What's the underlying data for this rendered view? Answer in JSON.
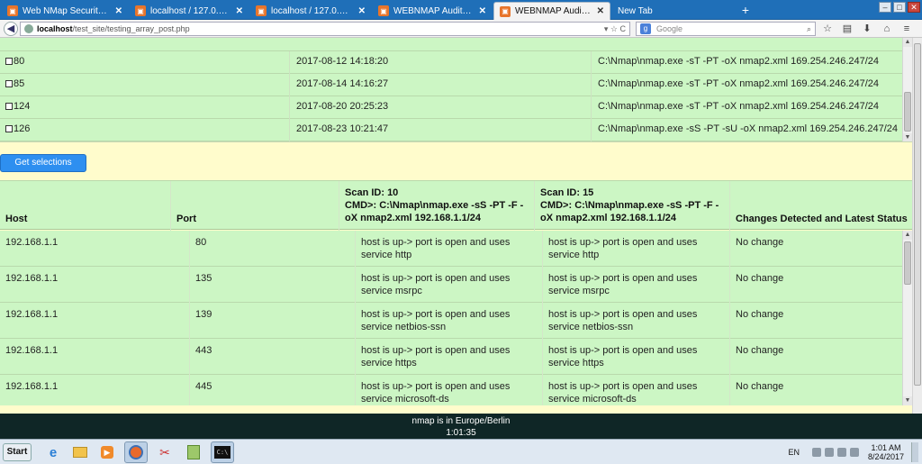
{
  "browser": {
    "tabs": [
      {
        "title": "Web NMap Security Auditing ...",
        "icon": "orange-app-icon",
        "active": false
      },
      {
        "title": "localhost / 127.0.0.1 / auditd...",
        "icon": "orange-app-icon",
        "active": false
      },
      {
        "title": "localhost / 127.0.0.1 / auditd...",
        "icon": "orange-app-icon",
        "active": false
      },
      {
        "title": "WEBNMAP Audit Tool",
        "icon": "orange-app-icon",
        "active": false
      },
      {
        "title": "WEBNMAP Audit Tool",
        "icon": "orange-app-icon",
        "active": true
      },
      {
        "title": "New Tab",
        "icon": "blank-page-icon",
        "active": false
      }
    ],
    "new_tab_label": "+",
    "url_host": "localhost",
    "url_path": "/test_site/testing_array_post.php",
    "search_placeholder": "Google"
  },
  "scan_list": {
    "rows": [
      {
        "id": "80",
        "date": "2017-08-12 14:18:20",
        "cmd": "C:\\Nmap\\nmap.exe -sT -PT -oX nmap2.xml 169.254.246.247/24"
      },
      {
        "id": "85",
        "date": "2017-08-14 14:16:27",
        "cmd": "C:\\Nmap\\nmap.exe -sT -PT -oX nmap2.xml 169.254.246.247/24"
      },
      {
        "id": "124",
        "date": "2017-08-20 20:25:23",
        "cmd": "C:\\Nmap\\nmap.exe -sT -PT -oX nmap2.xml 169.254.246.247/24"
      },
      {
        "id": "126",
        "date": "2017-08-23 10:21:47",
        "cmd": "C:\\Nmap\\nmap.exe -sS -PT -sU -oX nmap2.xml 169.254.246.247/24"
      }
    ]
  },
  "get_selections_label": "Get selections",
  "results": {
    "headers": {
      "host": "Host",
      "port": "Port",
      "scan_a_id": "Scan ID: 10",
      "scan_a_cmd": "CMD>: C:\\Nmap\\nmap.exe -sS -PT -F -oX nmap2.xml 192.168.1.1/24",
      "scan_b_id": "Scan ID: 15",
      "scan_b_cmd": "CMD>: C:\\Nmap\\nmap.exe -sS -PT -F -oX nmap2.xml 192.168.1.1/24",
      "changes": "Changes Detected and Latest Status"
    },
    "rows": [
      {
        "host": "192.168.1.1",
        "port": "80",
        "scan_a": "host is up-> port is open and uses service http",
        "scan_b": "host is up-> port is open and uses service http",
        "status": "No change"
      },
      {
        "host": "192.168.1.1",
        "port": "135",
        "scan_a": "host is up-> port is open and uses service msrpc",
        "scan_b": "host is up-> port is open and uses service msrpc",
        "status": "No change"
      },
      {
        "host": "192.168.1.1",
        "port": "139",
        "scan_a": "host is up-> port is open and uses service netbios-ssn",
        "scan_b": "host is up-> port is open and uses service netbios-ssn",
        "status": "No change"
      },
      {
        "host": "192.168.1.1",
        "port": "443",
        "scan_a": "host is up-> port is open and uses service https",
        "scan_b": "host is up-> port is open and uses service https",
        "status": "No change"
      },
      {
        "host": "192.168.1.1",
        "port": "445",
        "scan_a": "host is up-> port is open and uses service microsoft-ds",
        "scan_b": "host is up-> port is open and uses service microsoft-ds",
        "status": "No change"
      }
    ]
  },
  "status_bar": {
    "line1": "nmap is in Europe/Berlin",
    "line2": "1:01:35"
  },
  "taskbar": {
    "start_label": "Start",
    "lang": "EN",
    "time": "1:01 AM",
    "date": "8/24/2017"
  }
}
